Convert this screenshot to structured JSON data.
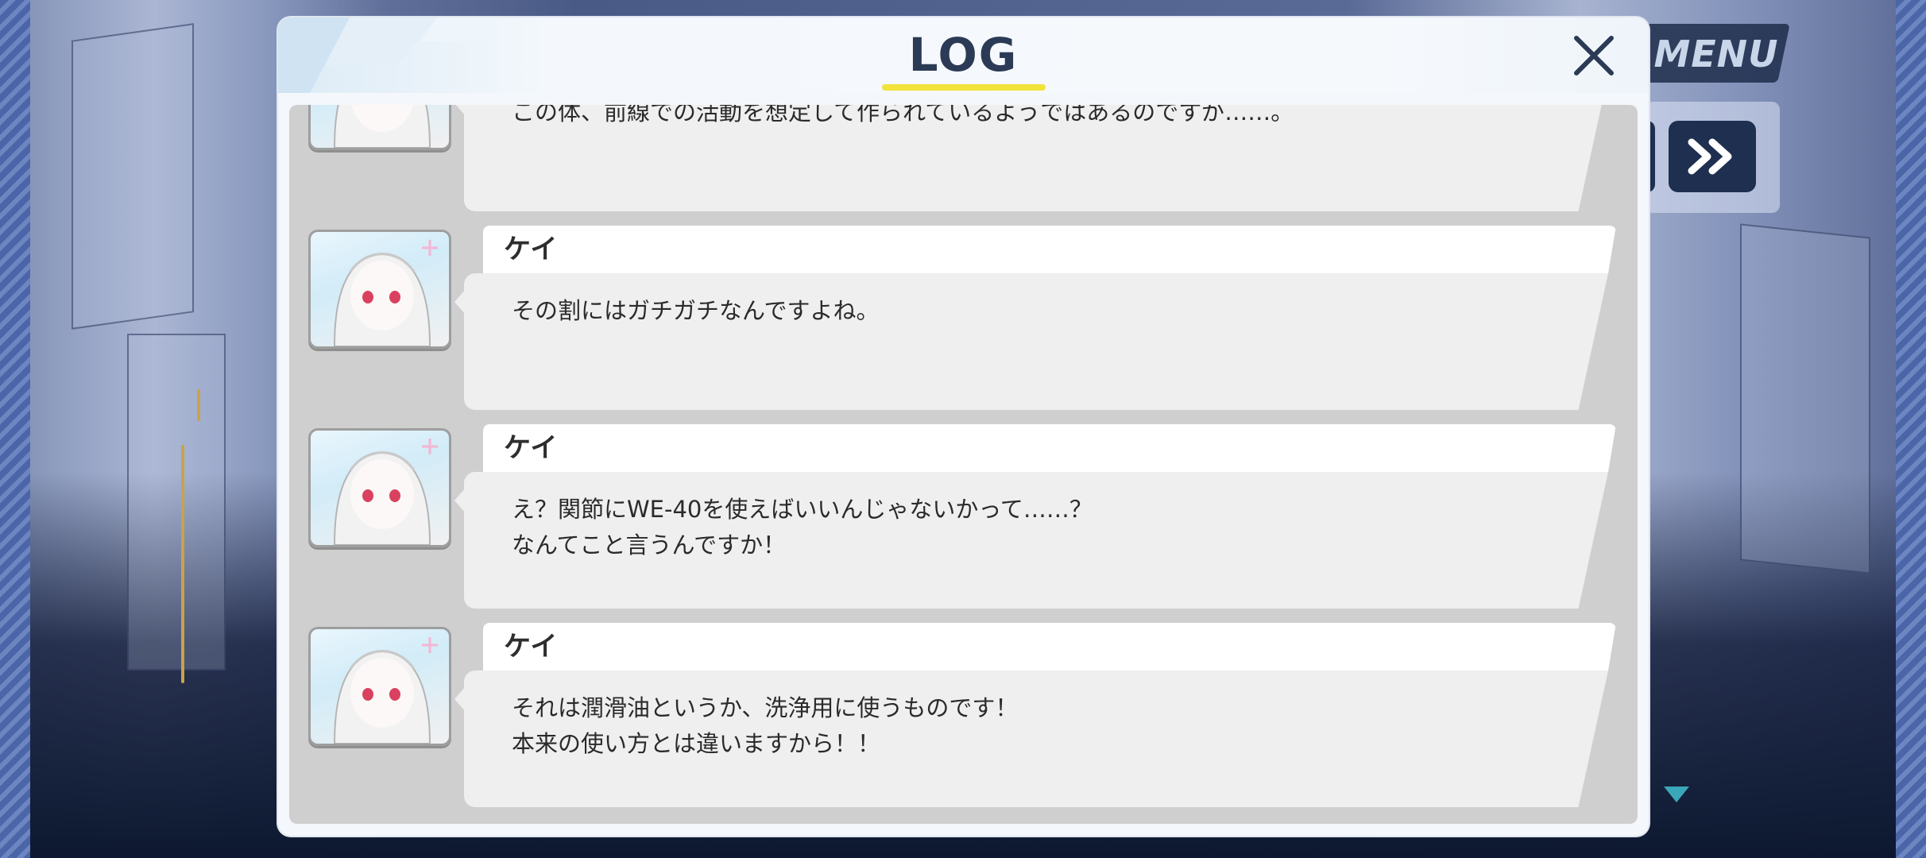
{
  "hud": {
    "menu_label": "MENU",
    "fast_forward_icon": "double-chevron-right-icon"
  },
  "dialog": {
    "title": "LOG",
    "close_icon": "close-icon"
  },
  "entries": [
    {
      "speaker": "",
      "message": "この体、前線での活動を想定して作られているようではあるのですが……。"
    },
    {
      "speaker": "ケイ",
      "message": "その割にはガチガチなんですよね。"
    },
    {
      "speaker": "ケイ",
      "message": "え？関節にWE-40を使えばいいんじゃないかって……？\nなんてこと言うんですか！"
    },
    {
      "speaker": "ケイ",
      "message": "それは潤滑油というか、洗浄用に使うものです！\n本来の使い方とは違いますから！！"
    }
  ],
  "colors": {
    "accent_underline": "#f2e33a",
    "title_text": "#2b3a55",
    "hud_button": "#1e2f4f"
  }
}
